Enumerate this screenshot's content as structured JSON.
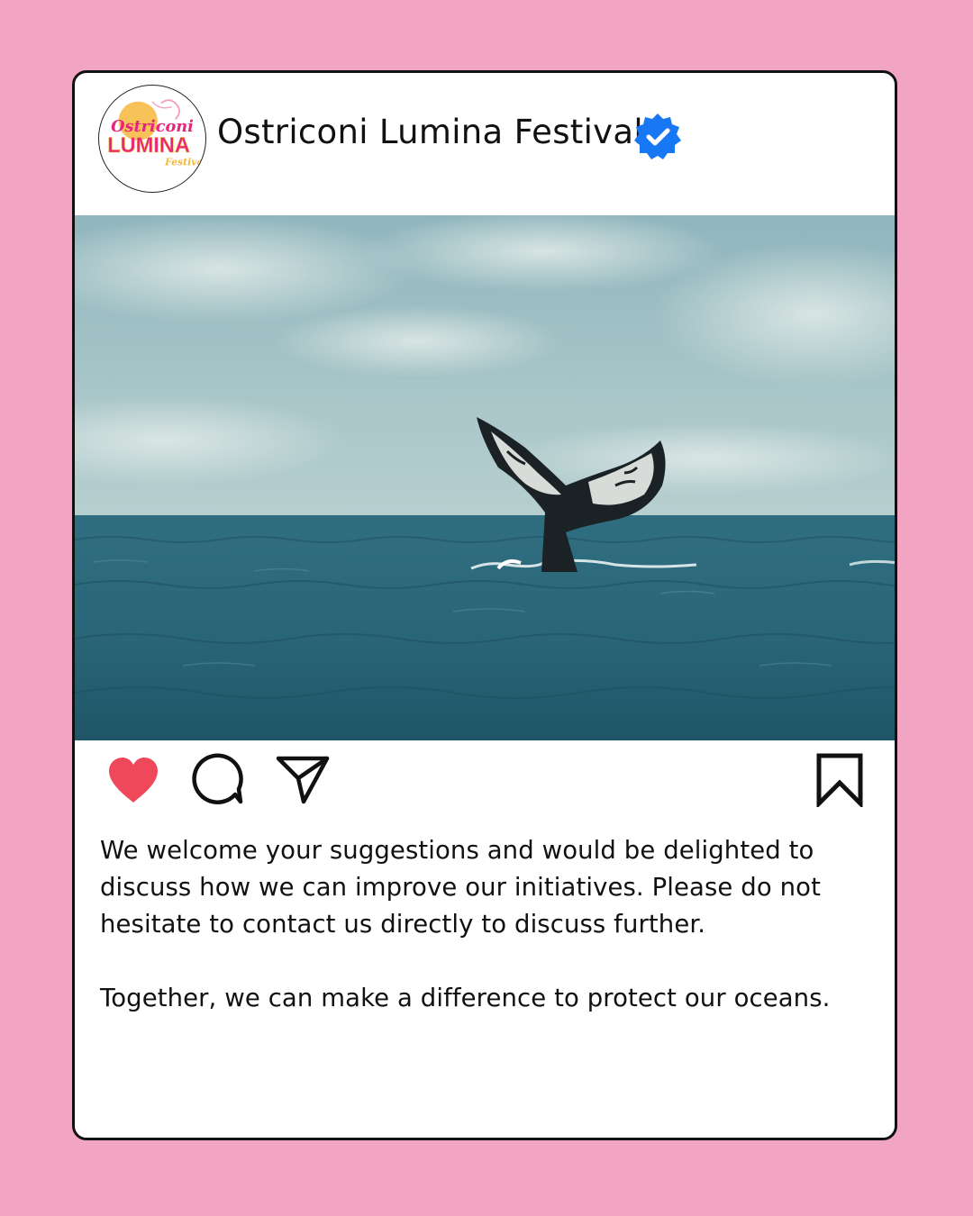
{
  "post": {
    "account_name": "Ostriconi Lumina Festival",
    "verified": true,
    "logo": {
      "line1": "Ostriconi",
      "line2": "LUMINA",
      "line3": "Festival"
    },
    "image": {
      "subject": "whale-tail-ocean",
      "alt": ""
    },
    "actions": {
      "like_icon": "heart-icon",
      "liked": true,
      "comment_icon": "comment-icon",
      "share_icon": "send-icon",
      "save_icon": "bookmark-icon"
    },
    "caption": {
      "paragraph1": "We welcome your suggestions and would be delighted to discuss how we can improve our initiatives. Please do not hesitate to contact us directly to discuss further.",
      "paragraph2": "Together, we can make a difference to protect our oceans."
    }
  },
  "colors": {
    "background": "#f2a5c3",
    "card": "#ffffff",
    "heart": "#f0485b",
    "verified": "#1877f2",
    "logo_pink": "#e8257e",
    "logo_yellow": "#f6b93b"
  }
}
